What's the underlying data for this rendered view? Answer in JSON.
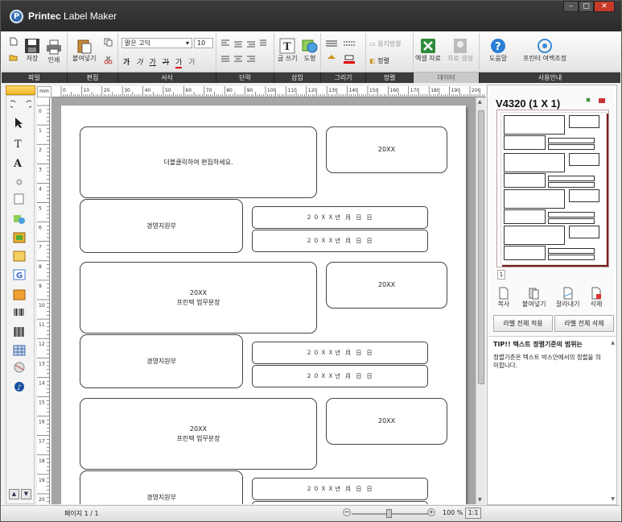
{
  "window": {
    "title_brand": "Printec",
    "title_rest": " Label Maker",
    "logo_letter": "P",
    "min": "–",
    "max": "□",
    "close": "✕"
  },
  "ribbon": {
    "file": {
      "save": "저장",
      "print": "인쇄"
    },
    "edit": {
      "paste": "붙여넣기"
    },
    "format": {
      "font_name": "맑은 고딕",
      "font_size": "10",
      "bold": "가",
      "italic": "가",
      "underline": "가",
      "strike": "가",
      "color": "가",
      "shadow": "가"
    },
    "insert": {
      "text": "글 쓰기",
      "shape": "도형"
    },
    "align": {
      "paper_dir": "용지방향",
      "align": "정렬"
    },
    "data": {
      "excel": "엑셀 자료",
      "datagen": "자료 생성"
    },
    "help": {
      "help": "도움말",
      "margin": "프린터 여백조정"
    }
  },
  "groups": [
    "파일",
    "편집",
    "서식",
    "단락",
    "삽입",
    "그리기",
    "정렬",
    "데이터",
    "사용안내"
  ],
  "ruler": {
    "unit": "mm",
    "top_ticks": [
      "0",
      "10",
      "20",
      "30",
      "40",
      "50",
      "60",
      "70",
      "80",
      "90",
      "100",
      "110",
      "120",
      "130",
      "140",
      "150",
      "160",
      "170",
      "180",
      "190",
      "200"
    ],
    "left_ticks": [
      "0",
      "1",
      "2",
      "3",
      "4",
      "5",
      "6",
      "7",
      "8",
      "9",
      "10",
      "11",
      "12",
      "13",
      "14",
      "15",
      "16",
      "17",
      "18",
      "19",
      "20"
    ]
  },
  "labels": {
    "big1": "더블클릭하여 편집하세요.",
    "small_year": "20XX",
    "dept": "경영지원부",
    "date_stamp": "２０ＸＸ년 月 日 日",
    "big2": "20XX\n프린텍 업무분장"
  },
  "panel": {
    "title": "V4320 (1 X 1)",
    "page_num": "1",
    "actions": [
      "복사",
      "붙여넣기",
      "잘라내기",
      "삭제"
    ],
    "apply_all": "라벨 전체 적용",
    "delete_all": "라벨 전체 삭제",
    "tip_title": "TIP!! 텍스트 정렬기준의 범위는",
    "tip_text": "정렬기준은 텍스트 박스안에서의 정렬을 의미합니다."
  },
  "status": {
    "page": "페이지 1 / 1",
    "zoom": "100 %",
    "ratio": "1:1",
    "zoom_out": "−",
    "zoom_in": "+"
  }
}
